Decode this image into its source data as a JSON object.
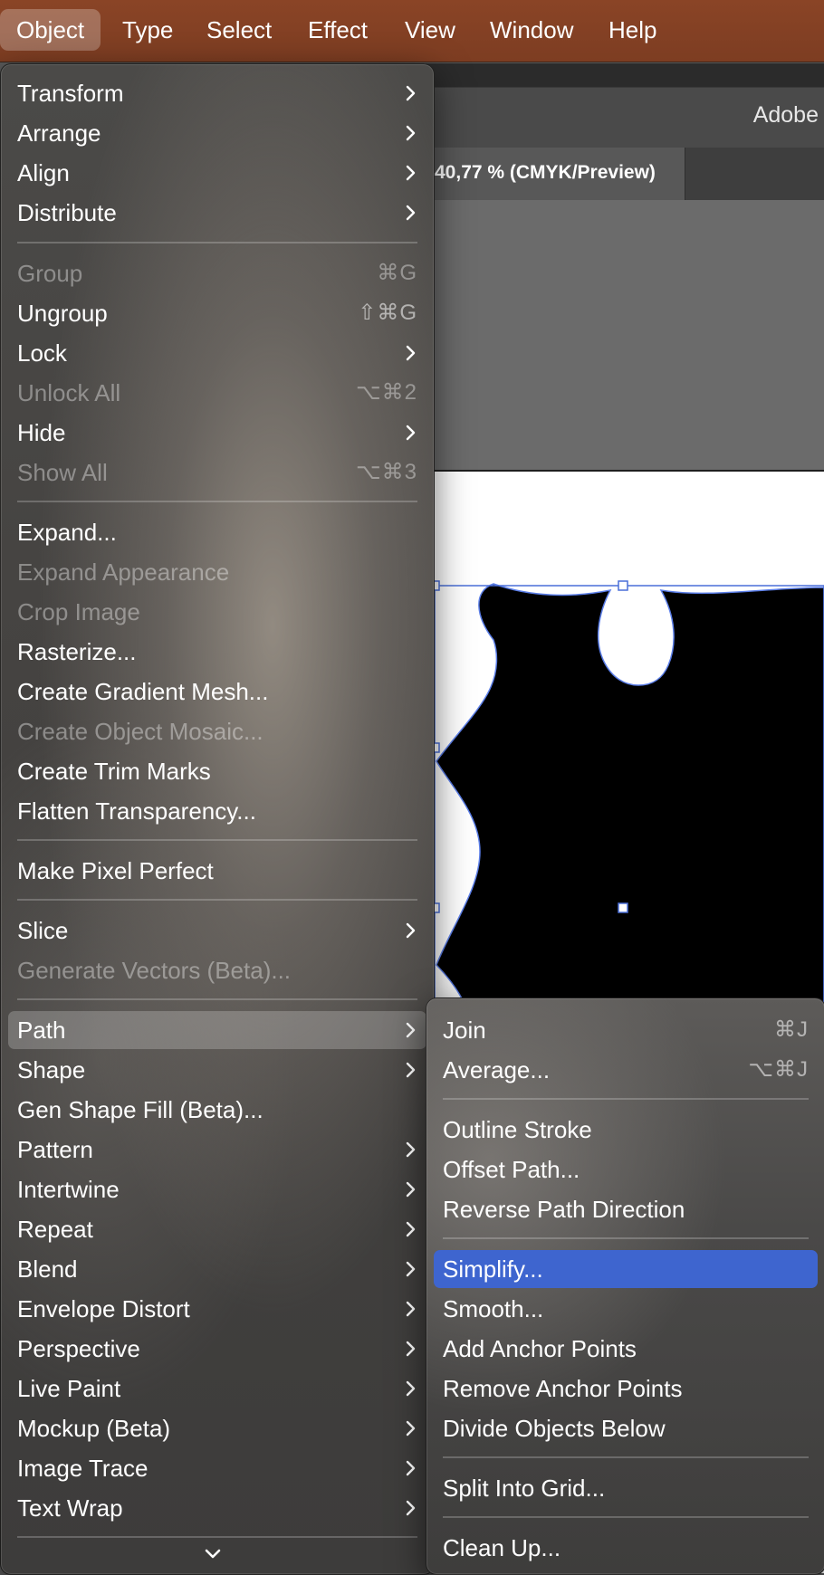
{
  "menubar": {
    "items": [
      "Object",
      "Type",
      "Select",
      "Effect",
      "View",
      "Window",
      "Help"
    ],
    "active": "Object"
  },
  "app": {
    "title": "Adobe",
    "doc_tab": "40,77 % (CMYK/Preview)"
  },
  "object_menu": {
    "items": [
      {
        "label": "Transform",
        "submenu": true
      },
      {
        "label": "Arrange",
        "submenu": true
      },
      {
        "label": "Align",
        "submenu": true
      },
      {
        "label": "Distribute",
        "submenu": true
      },
      {
        "label": "Group",
        "shortcut": "⌘G",
        "disabled": true
      },
      {
        "label": "Ungroup",
        "shortcut": "⇧⌘G"
      },
      {
        "label": "Lock",
        "submenu": true
      },
      {
        "label": "Unlock All",
        "shortcut": "⌥⌘2",
        "disabled": true
      },
      {
        "label": "Hide",
        "submenu": true
      },
      {
        "label": "Show All",
        "shortcut": "⌥⌘3",
        "disabled": true
      },
      {
        "label": "Expand..."
      },
      {
        "label": "Expand Appearance",
        "disabled": true
      },
      {
        "label": "Crop Image",
        "disabled": true
      },
      {
        "label": "Rasterize..."
      },
      {
        "label": "Create Gradient Mesh..."
      },
      {
        "label": "Create Object Mosaic...",
        "disabled": true
      },
      {
        "label": "Create Trim Marks"
      },
      {
        "label": "Flatten Transparency..."
      },
      {
        "label": "Make Pixel Perfect"
      },
      {
        "label": "Slice",
        "submenu": true
      },
      {
        "label": "Generate Vectors (Beta)...",
        "disabled": true
      },
      {
        "label": "Path",
        "submenu": true,
        "highlighted": true
      },
      {
        "label": "Shape",
        "submenu": true
      },
      {
        "label": "Gen Shape Fill (Beta)..."
      },
      {
        "label": "Pattern",
        "submenu": true
      },
      {
        "label": "Intertwine",
        "submenu": true
      },
      {
        "label": "Repeat",
        "submenu": true
      },
      {
        "label": "Blend",
        "submenu": true
      },
      {
        "label": "Envelope Distort",
        "submenu": true
      },
      {
        "label": "Perspective",
        "submenu": true
      },
      {
        "label": "Live Paint",
        "submenu": true
      },
      {
        "label": "Mockup (Beta)",
        "submenu": true
      },
      {
        "label": "Image Trace",
        "submenu": true
      },
      {
        "label": "Text Wrap",
        "submenu": true
      }
    ]
  },
  "path_submenu": {
    "items": [
      {
        "label": "Join",
        "shortcut": "⌘J"
      },
      {
        "label": "Average...",
        "shortcut": "⌥⌘J"
      },
      {
        "label": "Outline Stroke"
      },
      {
        "label": "Offset Path..."
      },
      {
        "label": "Reverse Path Direction"
      },
      {
        "label": "Simplify...",
        "selected": true
      },
      {
        "label": "Smooth..."
      },
      {
        "label": "Add Anchor Points"
      },
      {
        "label": "Remove Anchor Points"
      },
      {
        "label": "Divide Objects Below"
      },
      {
        "label": "Split Into Grid..."
      },
      {
        "label": "Clean Up..."
      }
    ]
  },
  "colors": {
    "menubar_bg": "#7d3d22",
    "selection_blue": "#3e65cf",
    "selection_outline": "#4a6fd8"
  },
  "icons": {
    "submenu": "chevron-right-icon",
    "more": "chevron-down-icon"
  }
}
